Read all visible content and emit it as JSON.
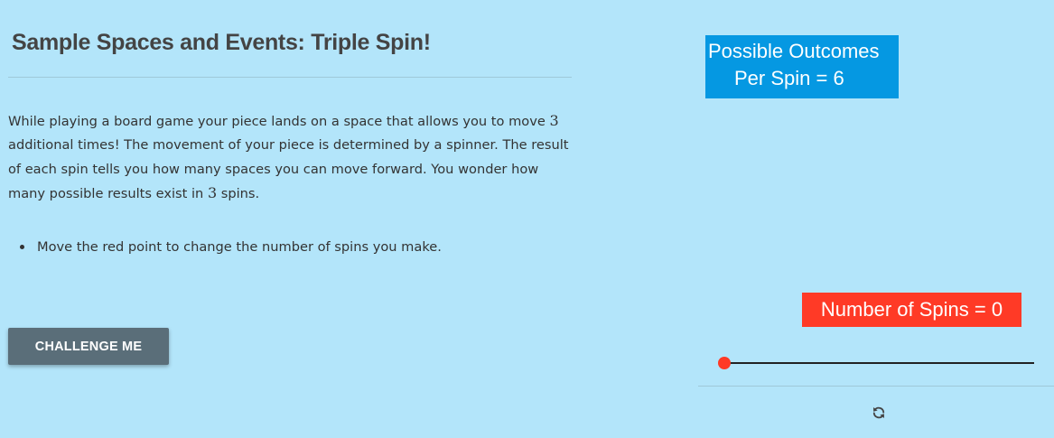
{
  "header": {
    "title": "Sample Spaces and Events: Triple Spin!"
  },
  "description": {
    "part1": "While playing a board game your piece lands on a space that allows you to move ",
    "num1": "3",
    "part2": " additional times! The movement of your piece is determined by a spinner. The result of each spin tells you how many spaces you can move forward. You wonder how many possible results exist in ",
    "num2": "3",
    "part3": " spins."
  },
  "instructions": [
    "Move the red point to change the number of spins you make."
  ],
  "challenge_button": {
    "label": "CHALLENGE ME"
  },
  "outcomes_box": {
    "line1": "Possible Outcomes",
    "line2": "Per Spin = 6",
    "color": "#0598e2"
  },
  "spins_box": {
    "label": "Number of Spins = 0",
    "color": "#ff3a26"
  },
  "slider": {
    "value": 0,
    "color": "#ff3a26"
  },
  "reset": {
    "icon": "refresh-icon"
  },
  "colors": {
    "background": "#b3e5fa",
    "button": "#5a6e79"
  }
}
